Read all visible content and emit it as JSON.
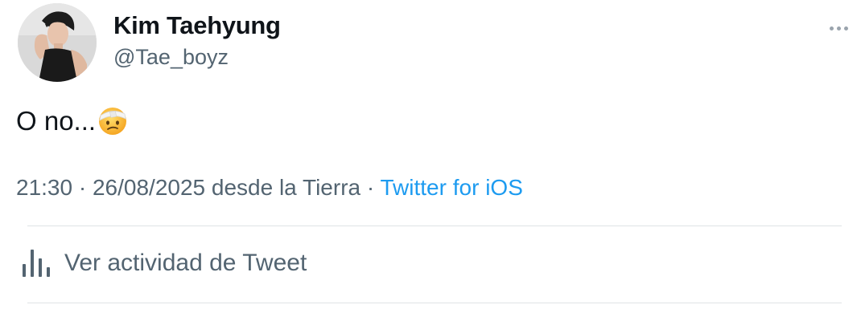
{
  "user": {
    "display_name": "Kim Taehyung",
    "handle": "@Tae_boyz"
  },
  "tweet": {
    "text": "O no...",
    "emoji": "face-with-head-bandage"
  },
  "meta": {
    "time": "21:30",
    "separator_1": " · ",
    "date": "26/08/2025",
    "location": " desde la Tierra",
    "separator_2": " · ",
    "source": "Twitter for iOS"
  },
  "activity": {
    "label": "Ver actividad de Tweet",
    "icon": "bar-chart-icon"
  },
  "colors": {
    "text": "#0f1419",
    "secondary": "#536471",
    "link": "#1d9bf0",
    "divider": "#dfe3e6"
  }
}
